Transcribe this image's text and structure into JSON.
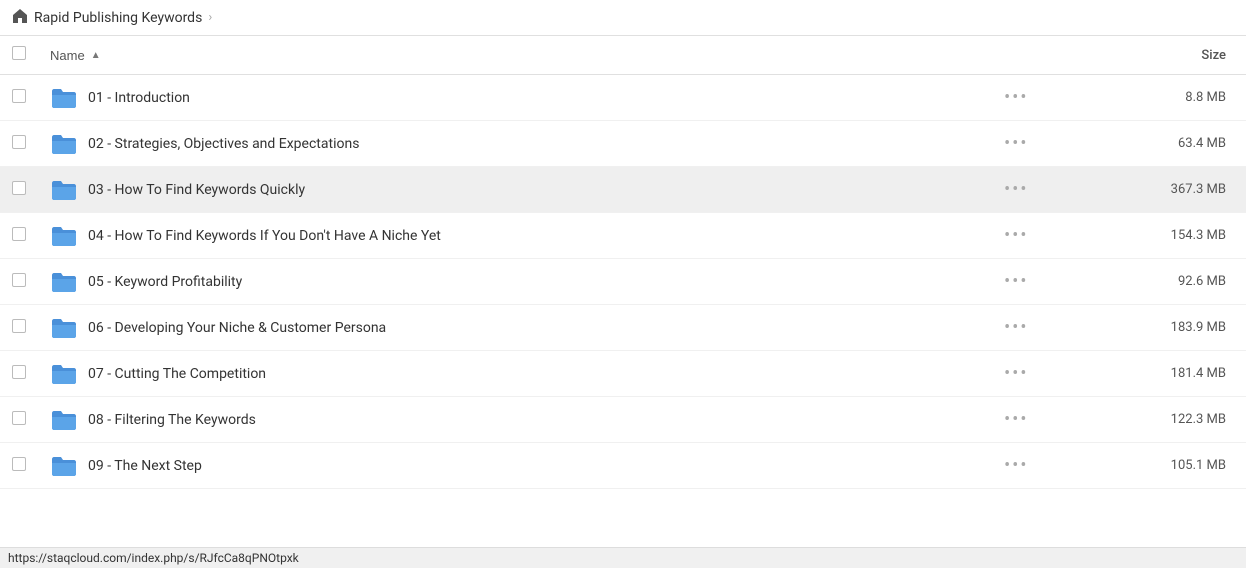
{
  "breadcrumb": {
    "home_icon": "home-icon",
    "title": "Rapid Publishing Keywords",
    "chevron": "›"
  },
  "table": {
    "col_check_label": "",
    "col_name_label": "Name",
    "col_name_sort": "▲",
    "col_actions_label": "",
    "col_size_label": "Size",
    "rows": [
      {
        "id": 1,
        "name": "01 - Introduction",
        "size": "8.8 MB",
        "hover": false
      },
      {
        "id": 2,
        "name": "02 - Strategies, Objectives and Expectations",
        "size": "63.4 MB",
        "hover": false
      },
      {
        "id": 3,
        "name": "03 - How To Find Keywords Quickly",
        "size": "367.3 MB",
        "hover": true
      },
      {
        "id": 4,
        "name": "04 - How To Find Keywords If You Don't Have A Niche Yet",
        "size": "154.3 MB",
        "hover": false
      },
      {
        "id": 5,
        "name": "05 - Keyword Profitability",
        "size": "92.6 MB",
        "hover": false
      },
      {
        "id": 6,
        "name": "06 - Developing Your Niche & Customer Persona",
        "size": "183.9 MB",
        "hover": false
      },
      {
        "id": 7,
        "name": "07 - Cutting The Competition",
        "size": "181.4 MB",
        "hover": false
      },
      {
        "id": 8,
        "name": "08 - Filtering The Keywords",
        "size": "122.3 MB",
        "hover": false
      },
      {
        "id": 9,
        "name": "09 - The Next Step",
        "size": "105.1 MB",
        "hover": false
      }
    ]
  },
  "status_bar": {
    "url": "https://staqcloud.com/index.php/s/RJfcCa8qPNOtpxk"
  },
  "dots_label": "•••"
}
